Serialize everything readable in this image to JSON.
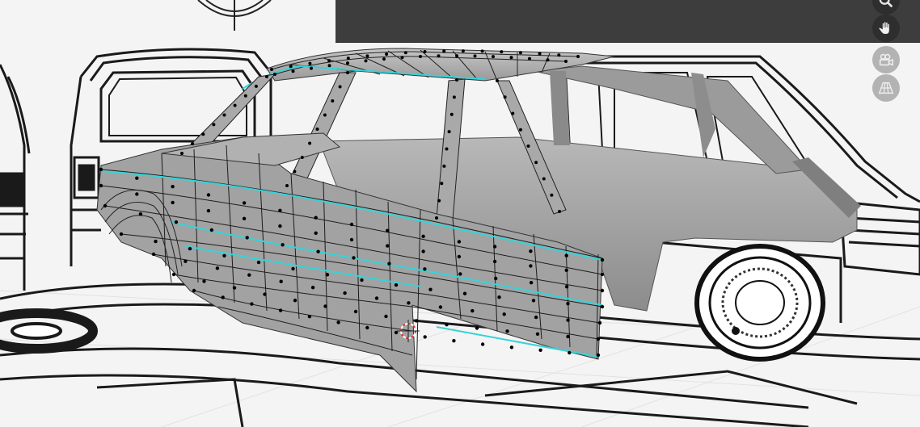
{
  "viewport": {
    "mode": "3d-viewport",
    "accent_edge_color": "#36d3d8",
    "vertex_color": "#000000",
    "mesh_face_color": "#a6a6a6",
    "header_color": "#3d3d3d"
  },
  "navigation_gizmos": [
    {
      "name": "zoom",
      "icon": "magnifier-icon"
    },
    {
      "name": "pan",
      "icon": "hand-icon"
    },
    {
      "name": "camera-view",
      "icon": "camera-icon"
    },
    {
      "name": "perspective-toggle",
      "icon": "grid-icon"
    }
  ]
}
